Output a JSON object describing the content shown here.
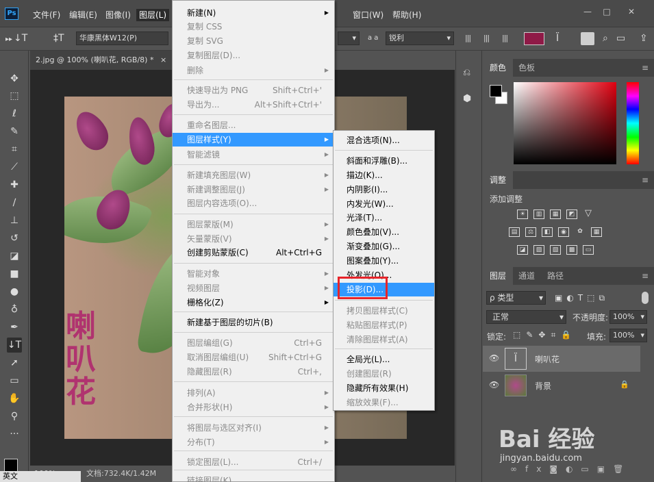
{
  "app": {
    "logo": "Ps"
  },
  "menubar": {
    "items": [
      "文件(F)",
      "编辑(E)",
      "图像(I)",
      "图层(L)",
      "窗口(W)",
      "帮助(H)"
    ],
    "window_buttons": [
      "—",
      "□",
      "✕"
    ]
  },
  "options": {
    "font_name": "华康黑体W12(P)",
    "antialias_icon": "a a",
    "antialias": "锐利"
  },
  "document": {
    "tab_title": "2.jpg @ 100% (喇叭花, RGB/8) *",
    "tab_close": "×",
    "photo_text": "喇叭花",
    "status_zoom": "100%",
    "status_doc": "文档:732.4K/1.42M"
  },
  "ime": {
    "label": "英文"
  },
  "layer_menu": {
    "items": [
      {
        "label": "新建(N)",
        "shortcut": "",
        "submenu": true,
        "disabled": false
      },
      {
        "label": "复制 CSS",
        "shortcut": "",
        "submenu": false,
        "disabled": true
      },
      {
        "label": "复制 SVG",
        "shortcut": "",
        "submenu": false,
        "disabled": true
      },
      {
        "label": "复制图层(D)...",
        "shortcut": "",
        "submenu": false,
        "disabled": true
      },
      {
        "label": "删除",
        "shortcut": "",
        "submenu": true,
        "disabled": true
      },
      {
        "label": "快速导出为 PNG",
        "shortcut": "Shift+Ctrl+'",
        "submenu": false,
        "disabled": true
      },
      {
        "label": "导出为...",
        "shortcut": "Alt+Shift+Ctrl+'",
        "submenu": false,
        "disabled": true
      },
      {
        "label": "重命名图层...",
        "shortcut": "",
        "submenu": false,
        "disabled": true
      },
      {
        "label": "图层样式(Y)",
        "shortcut": "",
        "submenu": true,
        "disabled": false,
        "highlighted": true
      },
      {
        "label": "智能滤镜",
        "shortcut": "",
        "submenu": true,
        "disabled": true
      },
      {
        "label": "新建填充图层(W)",
        "shortcut": "",
        "submenu": true,
        "disabled": true
      },
      {
        "label": "新建调整图层(J)",
        "shortcut": "",
        "submenu": true,
        "disabled": true
      },
      {
        "label": "图层内容选项(O)...",
        "shortcut": "",
        "submenu": false,
        "disabled": true
      },
      {
        "label": "图层蒙版(M)",
        "shortcut": "",
        "submenu": true,
        "disabled": true
      },
      {
        "label": "矢量蒙版(V)",
        "shortcut": "",
        "submenu": true,
        "disabled": true
      },
      {
        "label": "创建剪贴蒙版(C)",
        "shortcut": "Alt+Ctrl+G",
        "submenu": false,
        "disabled": false
      },
      {
        "label": "智能对象",
        "shortcut": "",
        "submenu": true,
        "disabled": true
      },
      {
        "label": "视频图层",
        "shortcut": "",
        "submenu": true,
        "disabled": true
      },
      {
        "label": "栅格化(Z)",
        "shortcut": "",
        "submenu": true,
        "disabled": false
      },
      {
        "label": "新建基于图层的切片(B)",
        "shortcut": "",
        "submenu": false,
        "disabled": false
      },
      {
        "label": "图层编组(G)",
        "shortcut": "Ctrl+G",
        "submenu": false,
        "disabled": true
      },
      {
        "label": "取消图层编组(U)",
        "shortcut": "Shift+Ctrl+G",
        "submenu": false,
        "disabled": true
      },
      {
        "label": "隐藏图层(R)",
        "shortcut": "Ctrl+,",
        "submenu": false,
        "disabled": true
      },
      {
        "label": "排列(A)",
        "shortcut": "",
        "submenu": true,
        "disabled": true
      },
      {
        "label": "合并形状(H)",
        "shortcut": "",
        "submenu": true,
        "disabled": true
      },
      {
        "label": "将图层与选区对齐(I)",
        "shortcut": "",
        "submenu": true,
        "disabled": true
      },
      {
        "label": "分布(T)",
        "shortcut": "",
        "submenu": true,
        "disabled": true
      },
      {
        "label": "锁定图层(L)...",
        "shortcut": "Ctrl+/",
        "submenu": false,
        "disabled": true
      },
      {
        "label": "链接图层(K)",
        "shortcut": "",
        "submenu": false,
        "disabled": true
      }
    ]
  },
  "style_menu": {
    "items": [
      {
        "label": "混合选项(N)...",
        "disabled": false
      },
      {
        "label": "斜面和浮雕(B)...",
        "disabled": false
      },
      {
        "label": "描边(K)...",
        "disabled": false
      },
      {
        "label": "内阴影(I)...",
        "disabled": false
      },
      {
        "label": "内发光(W)...",
        "disabled": false
      },
      {
        "label": "光泽(T)...",
        "disabled": false
      },
      {
        "label": "颜色叠加(V)...",
        "disabled": false
      },
      {
        "label": "渐变叠加(G)...",
        "disabled": false
      },
      {
        "label": "图案叠加(Y)...",
        "disabled": false
      },
      {
        "label": "外发光(O)...",
        "disabled": false
      },
      {
        "label": "投影(D)...",
        "disabled": false,
        "highlighted": true
      },
      {
        "label": "拷贝图层样式(C)",
        "disabled": true
      },
      {
        "label": "粘贴图层样式(P)",
        "disabled": true
      },
      {
        "label": "清除图层样式(A)",
        "disabled": true
      },
      {
        "label": "全局光(L)...",
        "disabled": false
      },
      {
        "label": "创建图层(R)",
        "disabled": true
      },
      {
        "label": "隐藏所有效果(H)",
        "disabled": false
      },
      {
        "label": "缩放效果(F)...",
        "disabled": true
      }
    ]
  },
  "color_panel": {
    "tabs": [
      "颜色",
      "色板"
    ],
    "fg": "#000000",
    "bg": "#ffffff"
  },
  "adjust_panel": {
    "tab": "调整",
    "title": "添加调整"
  },
  "layers_panel": {
    "tabs": [
      "图层",
      "通道",
      "路径"
    ],
    "filter_label": "ρ 类型",
    "blend_mode": "正常",
    "opacity_label": "不透明度:",
    "opacity": "100%",
    "lock_label": "锁定:",
    "fill_label": "填充:",
    "fill": "100%",
    "layers": [
      {
        "name": "喇叭花",
        "type": "text",
        "selected": true
      },
      {
        "name": "背景",
        "type": "image",
        "selected": false,
        "locked": true
      }
    ]
  },
  "watermark": {
    "brand": "Bai  经验",
    "url": "jingyan.baidu.com"
  },
  "colors": {
    "accent": "#3399ff",
    "highlight_box": "#e8242a",
    "text_color": "#b0336f",
    "swatch": "#8f1a47"
  }
}
